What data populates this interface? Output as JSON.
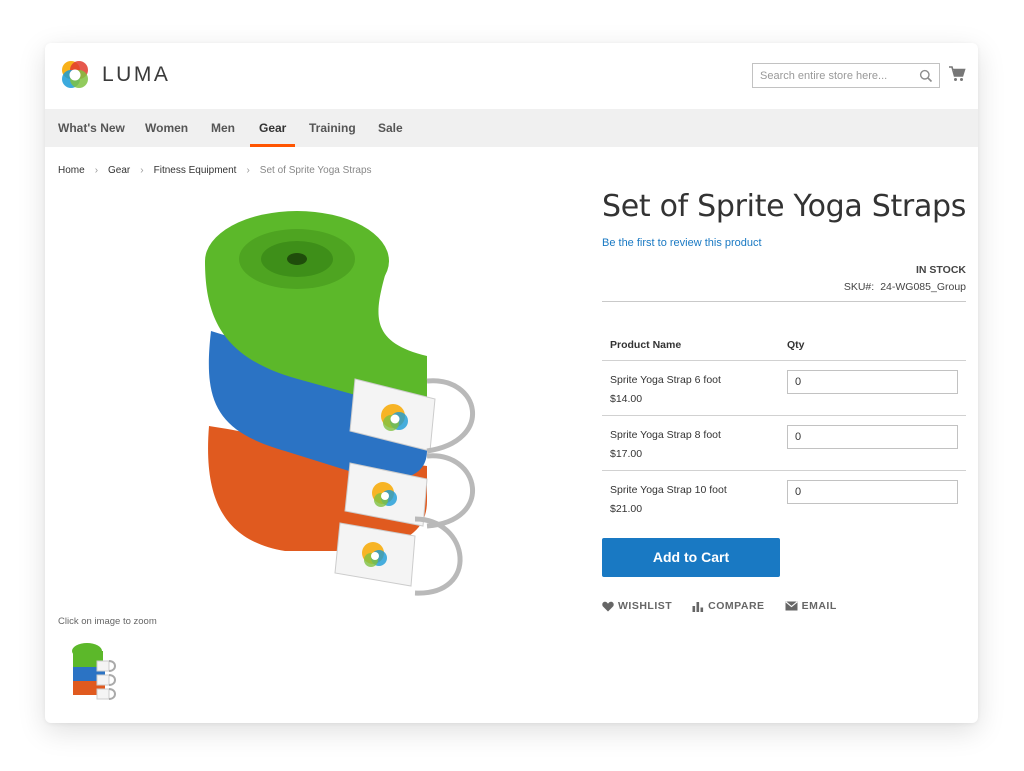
{
  "header": {
    "logo_text": "LUMA",
    "search_placeholder": "Search entire store here..."
  },
  "nav": {
    "items": [
      "What's New",
      "Women",
      "Men",
      "Gear",
      "Training",
      "Sale"
    ],
    "active": "Gear"
  },
  "breadcrumbs": {
    "items": [
      "Home",
      "Gear",
      "Fitness Equipment"
    ],
    "current": "Set of Sprite Yoga Straps"
  },
  "gallery": {
    "zoom_hint": "Click on image to zoom"
  },
  "product": {
    "title": "Set of Sprite Yoga Straps",
    "review_link": "Be the first to review this product",
    "stock": "IN STOCK",
    "sku_label": "SKU#:",
    "sku": "24-WG085_Group",
    "table": {
      "headers": [
        "Product Name",
        "Qty"
      ],
      "rows": [
        {
          "name": "Sprite Yoga Strap 6 foot",
          "price": "$14.00",
          "qty": "0"
        },
        {
          "name": "Sprite Yoga Strap 8 foot",
          "price": "$17.00",
          "qty": "0"
        },
        {
          "name": "Sprite Yoga Strap 10 foot",
          "price": "$21.00",
          "qty": "0"
        }
      ]
    },
    "add_to_cart": "Add to Cart",
    "actions": {
      "wishlist": "WISHLIST",
      "compare": "COMPARE",
      "email": "EMAIL"
    }
  },
  "colors": {
    "accent": "#1979c3",
    "nav_active_underline": "#ff5501",
    "strap_green": "#5cb82a",
    "strap_blue": "#2b73c4",
    "strap_orange": "#e05a1f"
  }
}
